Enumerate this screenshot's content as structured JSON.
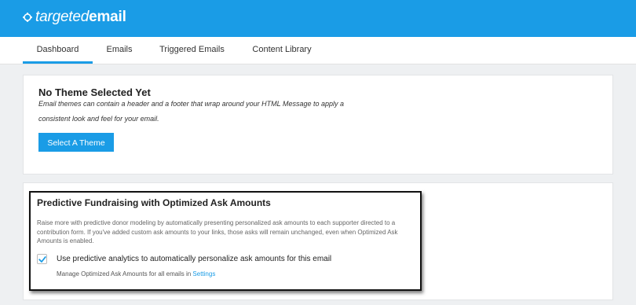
{
  "app": {
    "logo_light": "targeted",
    "logo_bold": "email"
  },
  "tabs": [
    {
      "label": "Dashboard",
      "active": true
    },
    {
      "label": "Emails",
      "active": false
    },
    {
      "label": "Triggered Emails",
      "active": false
    },
    {
      "label": "Content Library",
      "active": false
    }
  ],
  "theme_card": {
    "title": "No Theme Selected Yet",
    "description_line1": "Email themes can contain a header and a footer that wrap around your HTML Message to apply a",
    "description_line2": "consistent look and feel for your email.",
    "button_label": "Select A Theme"
  },
  "fundraising_card": {
    "title": "Predictive Fundraising with Optimized Ask Amounts",
    "description": "Raise more with predictive donor modeling by automatically presenting personalized ask amounts to each supporter directed to a contribution form. If you've added custom ask amounts to your links, those asks will remain unchanged, even when Optimized Ask Amounts is enabled.",
    "checkbox_label": "Use predictive analytics to automatically personalize ask amounts for this email",
    "checkbox_checked": true,
    "manage_text": "Manage Optimized Ask Amounts for all emails in ",
    "settings_link": "Settings"
  },
  "colors": {
    "accent": "#1a9ce6",
    "background": "#eef0f2"
  }
}
